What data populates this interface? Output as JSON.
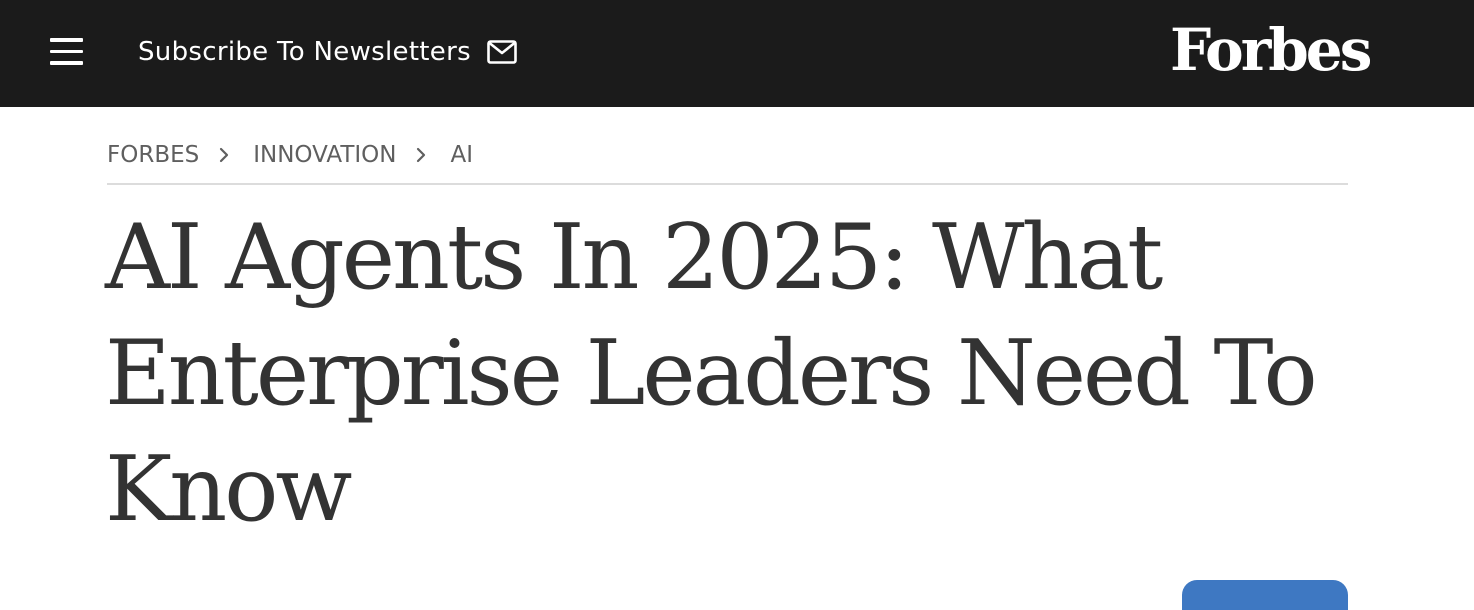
{
  "header": {
    "subscribe_label": "Subscribe To Newsletters",
    "logo_text": "Forbes",
    "menu_icon": "hamburger-menu-icon",
    "mail_icon": "envelope-icon",
    "background_color": "#1b1b1b"
  },
  "breadcrumb": {
    "items": [
      {
        "label": "FORBES"
      },
      {
        "label": "INNOVATION"
      },
      {
        "label": "AI"
      }
    ],
    "separator_icon": "chevron-right-icon"
  },
  "article": {
    "headline": "AI Agents In 2025: What Enterprise Leaders Need To Know"
  },
  "colors": {
    "text": "#333333",
    "breadcrumb": "#5f5f5f",
    "accent_blue": "#3e78c2"
  }
}
